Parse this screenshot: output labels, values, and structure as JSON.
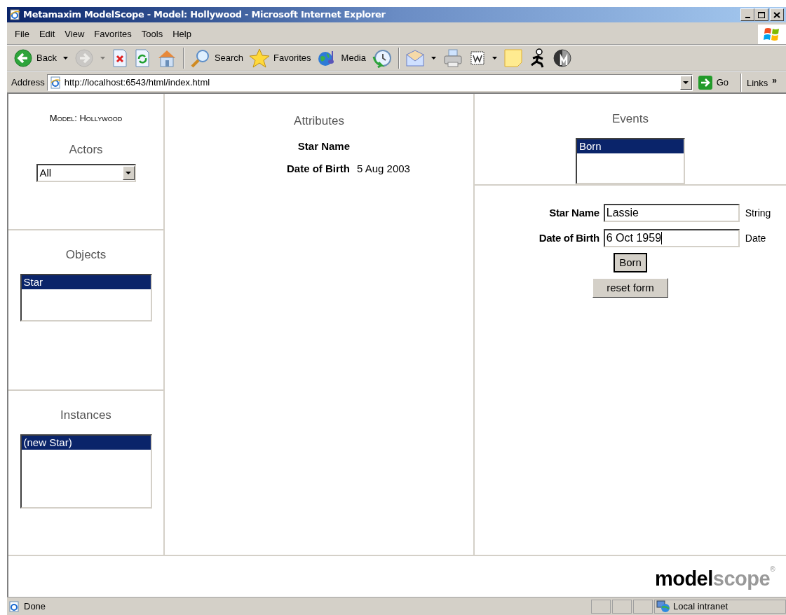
{
  "window": {
    "title": "Metamaxim ModelScope - Model: Hollywood - Microsoft Internet Explorer"
  },
  "menu": [
    {
      "label": "File"
    },
    {
      "label": "Edit"
    },
    {
      "label": "View"
    },
    {
      "label": "Favorites"
    },
    {
      "label": "Tools"
    },
    {
      "label": "Help"
    }
  ],
  "toolbar": [
    {
      "kind": "back",
      "label": "Back",
      "dropdown": true,
      "disabled": false
    },
    {
      "kind": "forward",
      "dropdown": true,
      "disabled": true
    },
    {
      "kind": "stop",
      "dropdown": false,
      "disabled": false
    },
    {
      "kind": "refresh",
      "dropdown": false,
      "disabled": false
    },
    {
      "kind": "home",
      "dropdown": false,
      "disabled": false
    },
    {
      "kind": "separator"
    },
    {
      "kind": "search",
      "label": "Search",
      "dropdown": false,
      "disabled": false
    },
    {
      "kind": "favorites",
      "label": "Favorites",
      "dropdown": false,
      "disabled": false
    },
    {
      "kind": "media",
      "label": "Media",
      "dropdown": false,
      "disabled": false
    },
    {
      "kind": "history",
      "dropdown": false,
      "disabled": false
    },
    {
      "kind": "separator"
    },
    {
      "kind": "mail",
      "dropdown": true,
      "disabled": false
    },
    {
      "kind": "print",
      "dropdown": false,
      "disabled": false
    },
    {
      "kind": "edit",
      "dropdown": true,
      "disabled": false
    },
    {
      "kind": "note",
      "dropdown": false,
      "disabled": false
    },
    {
      "kind": "messenger",
      "dropdown": false,
      "disabled": false
    },
    {
      "kind": "research",
      "dropdown": false,
      "disabled": false
    }
  ],
  "address": {
    "label": "Address",
    "url": "http://localhost:6543/html/index.html",
    "go": "Go",
    "links": "Links",
    "more": "»"
  },
  "page": {
    "model_title": "Model: Hollywood",
    "actors": {
      "heading": "Actors",
      "value": "All"
    },
    "objects": {
      "heading": "Objects",
      "items": [
        {
          "label": "Star",
          "selected": true
        }
      ]
    },
    "instances": {
      "heading": "Instances",
      "items": [
        {
          "label": "(new Star)",
          "selected": true
        }
      ]
    },
    "attributes": {
      "heading": "Attributes",
      "rows": [
        {
          "label": "Star Name"
        },
        {
          "label": "Date of Birth",
          "value": "5 Aug 2003"
        }
      ]
    },
    "events": {
      "heading": "Events",
      "items": [
        {
          "label": "Born",
          "selected": true
        }
      ]
    },
    "form": {
      "fields": [
        {
          "label": "Star Name",
          "value": "Lassie",
          "type": "String",
          "focused": false
        },
        {
          "label": "Date of Birth",
          "value": "6 Oct 1959",
          "type": "Date",
          "focused": true
        }
      ],
      "buttons": [
        {
          "kind": "submit",
          "label": "Born",
          "default": true
        },
        {
          "kind": "reset",
          "label": "reset form",
          "default": false
        }
      ]
    },
    "logo": {
      "primary": "model",
      "secondary": "scope",
      "mark": "®"
    }
  },
  "status_bar": {
    "text": "Done",
    "zone": "Local intranet"
  }
}
